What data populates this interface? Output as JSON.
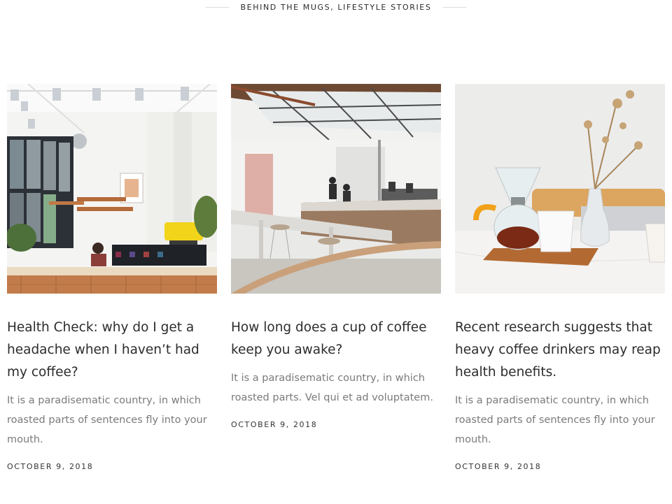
{
  "section": {
    "title": "BEHIND THE MUGS, LIFESTYLE STORIES"
  },
  "posts": [
    {
      "title": "Health Check: why do I get a headache when I haven’t had my coffee?",
      "excerpt": "It is a paradisematic country, in which roasted parts of sentences fly into your mouth.",
      "date": "OCTOBER 9, 2018",
      "image_icon": "cafe-interior-photo"
    },
    {
      "title": "How long does a cup of coffee keep you awake?",
      "excerpt": "It is a paradisematic country, in which roasted parts. Vel qui et ad voluptatem.",
      "date": "OCTOBER 9, 2018",
      "image_icon": "coffee-bar-photo"
    },
    {
      "title": "Recent research suggests that heavy coffee drinkers may reap health benefits.",
      "excerpt": "It is a paradisematic country, in which roasted parts of sentences fly into your mouth.",
      "date": "OCTOBER 9, 2018",
      "image_icon": "pour-over-coffee-photo"
    }
  ]
}
